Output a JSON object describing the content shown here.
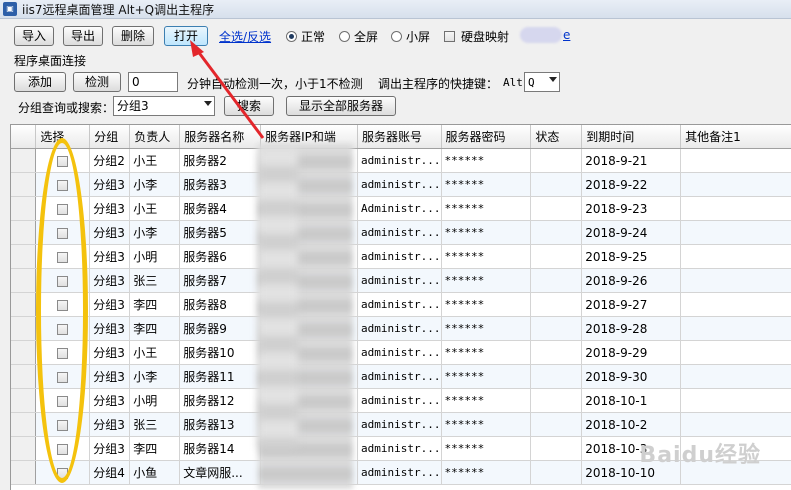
{
  "window": {
    "title": "iis7远程桌面管理 Alt+Q调出主程序"
  },
  "toolbar": {
    "import_label": "导入",
    "export_label": "导出",
    "delete_label": "删除",
    "open_label": "打开",
    "select_all_label": "全选/反选",
    "mode_normal": "正常",
    "mode_fullscreen": "全屏",
    "mode_small": "小屏",
    "disk_map_label": "硬盘映射"
  },
  "connect": {
    "section_label": "程序桌面连接",
    "add_label": "添加",
    "check_label": "检测",
    "interval_value": "0",
    "interval_text": "分钟自动检测一次，小于1不检测",
    "hotkey_text": "调出主程序的快捷键：",
    "hotkey_prefix": "Alt",
    "hotkey_value": "Q"
  },
  "search": {
    "label": "分组查询或搜索：",
    "group_value": "分组3",
    "search_button": "搜索",
    "show_all_button": "显示全部服务器"
  },
  "table": {
    "headers": [
      "选择",
      "分组",
      "负责人",
      "服务器名称",
      "服务器IP和端",
      "服务器账号",
      "服务器密码",
      "状态",
      "到期时间",
      "其他备注1"
    ],
    "rows": [
      {
        "group": "分组2",
        "owner": "小王",
        "name": "服务器2",
        "ip": "",
        "account": "administr...",
        "password": "******",
        "status": "",
        "expire": "2018-9-21",
        "note": ""
      },
      {
        "group": "分组3",
        "owner": "小李",
        "name": "服务器3",
        "ip": "",
        "account": "administr...",
        "password": "******",
        "status": "",
        "expire": "2018-9-22",
        "note": ""
      },
      {
        "group": "分组3",
        "owner": "小王",
        "name": "服务器4",
        "ip": "",
        "account": "Administr...",
        "password": "******",
        "status": "",
        "expire": "2018-9-23",
        "note": ""
      },
      {
        "group": "分组3",
        "owner": "小李",
        "name": "服务器5",
        "ip": "",
        "account": "administr...",
        "password": "******",
        "status": "",
        "expire": "2018-9-24",
        "note": ""
      },
      {
        "group": "分组3",
        "owner": "小明",
        "name": "服务器6",
        "ip": "",
        "account": "administr...",
        "password": "******",
        "status": "",
        "expire": "2018-9-25",
        "note": ""
      },
      {
        "group": "分组3",
        "owner": "张三",
        "name": "服务器7",
        "ip": "",
        "account": "administr...",
        "password": "******",
        "status": "",
        "expire": "2018-9-26",
        "note": ""
      },
      {
        "group": "分组3",
        "owner": "李四",
        "name": "服务器8",
        "ip": "",
        "account": "administr...",
        "password": "******",
        "status": "",
        "expire": "2018-9-27",
        "note": ""
      },
      {
        "group": "分组3",
        "owner": "李四",
        "name": "服务器9",
        "ip": "",
        "account": "administr...",
        "password": "******",
        "status": "",
        "expire": "2018-9-28",
        "note": ""
      },
      {
        "group": "分组3",
        "owner": "小王",
        "name": "服务器10",
        "ip": "",
        "account": "administr...",
        "password": "******",
        "status": "",
        "expire": "2018-9-29",
        "note": ""
      },
      {
        "group": "分组3",
        "owner": "小李",
        "name": "服务器11",
        "ip": "",
        "account": "administr...",
        "password": "******",
        "status": "",
        "expire": "2018-9-30",
        "note": ""
      },
      {
        "group": "分组3",
        "owner": "小明",
        "name": "服务器12",
        "ip": "",
        "account": "administr...",
        "password": "******",
        "status": "",
        "expire": "2018-10-1",
        "note": ""
      },
      {
        "group": "分组3",
        "owner": "张三",
        "name": "服务器13",
        "ip": "",
        "account": "administr...",
        "password": "******",
        "status": "",
        "expire": "2018-10-2",
        "note": ""
      },
      {
        "group": "分组3",
        "owner": "李四",
        "name": "服务器14",
        "ip": "",
        "account": "administr...",
        "password": "******",
        "status": "",
        "expire": "2018-10-3",
        "note": ""
      },
      {
        "group": "分组4",
        "owner": "小鱼",
        "name": "文章网服...",
        "ip": "",
        "account": "administr...",
        "password": "******",
        "status": "",
        "expire": "2018-10-10",
        "note": ""
      }
    ]
  },
  "watermark": "Baidu经验",
  "colors": {
    "annotation_arrow": "#e3262b",
    "annotation_ellipse": "#f4c20d",
    "link": "#0033cc"
  }
}
